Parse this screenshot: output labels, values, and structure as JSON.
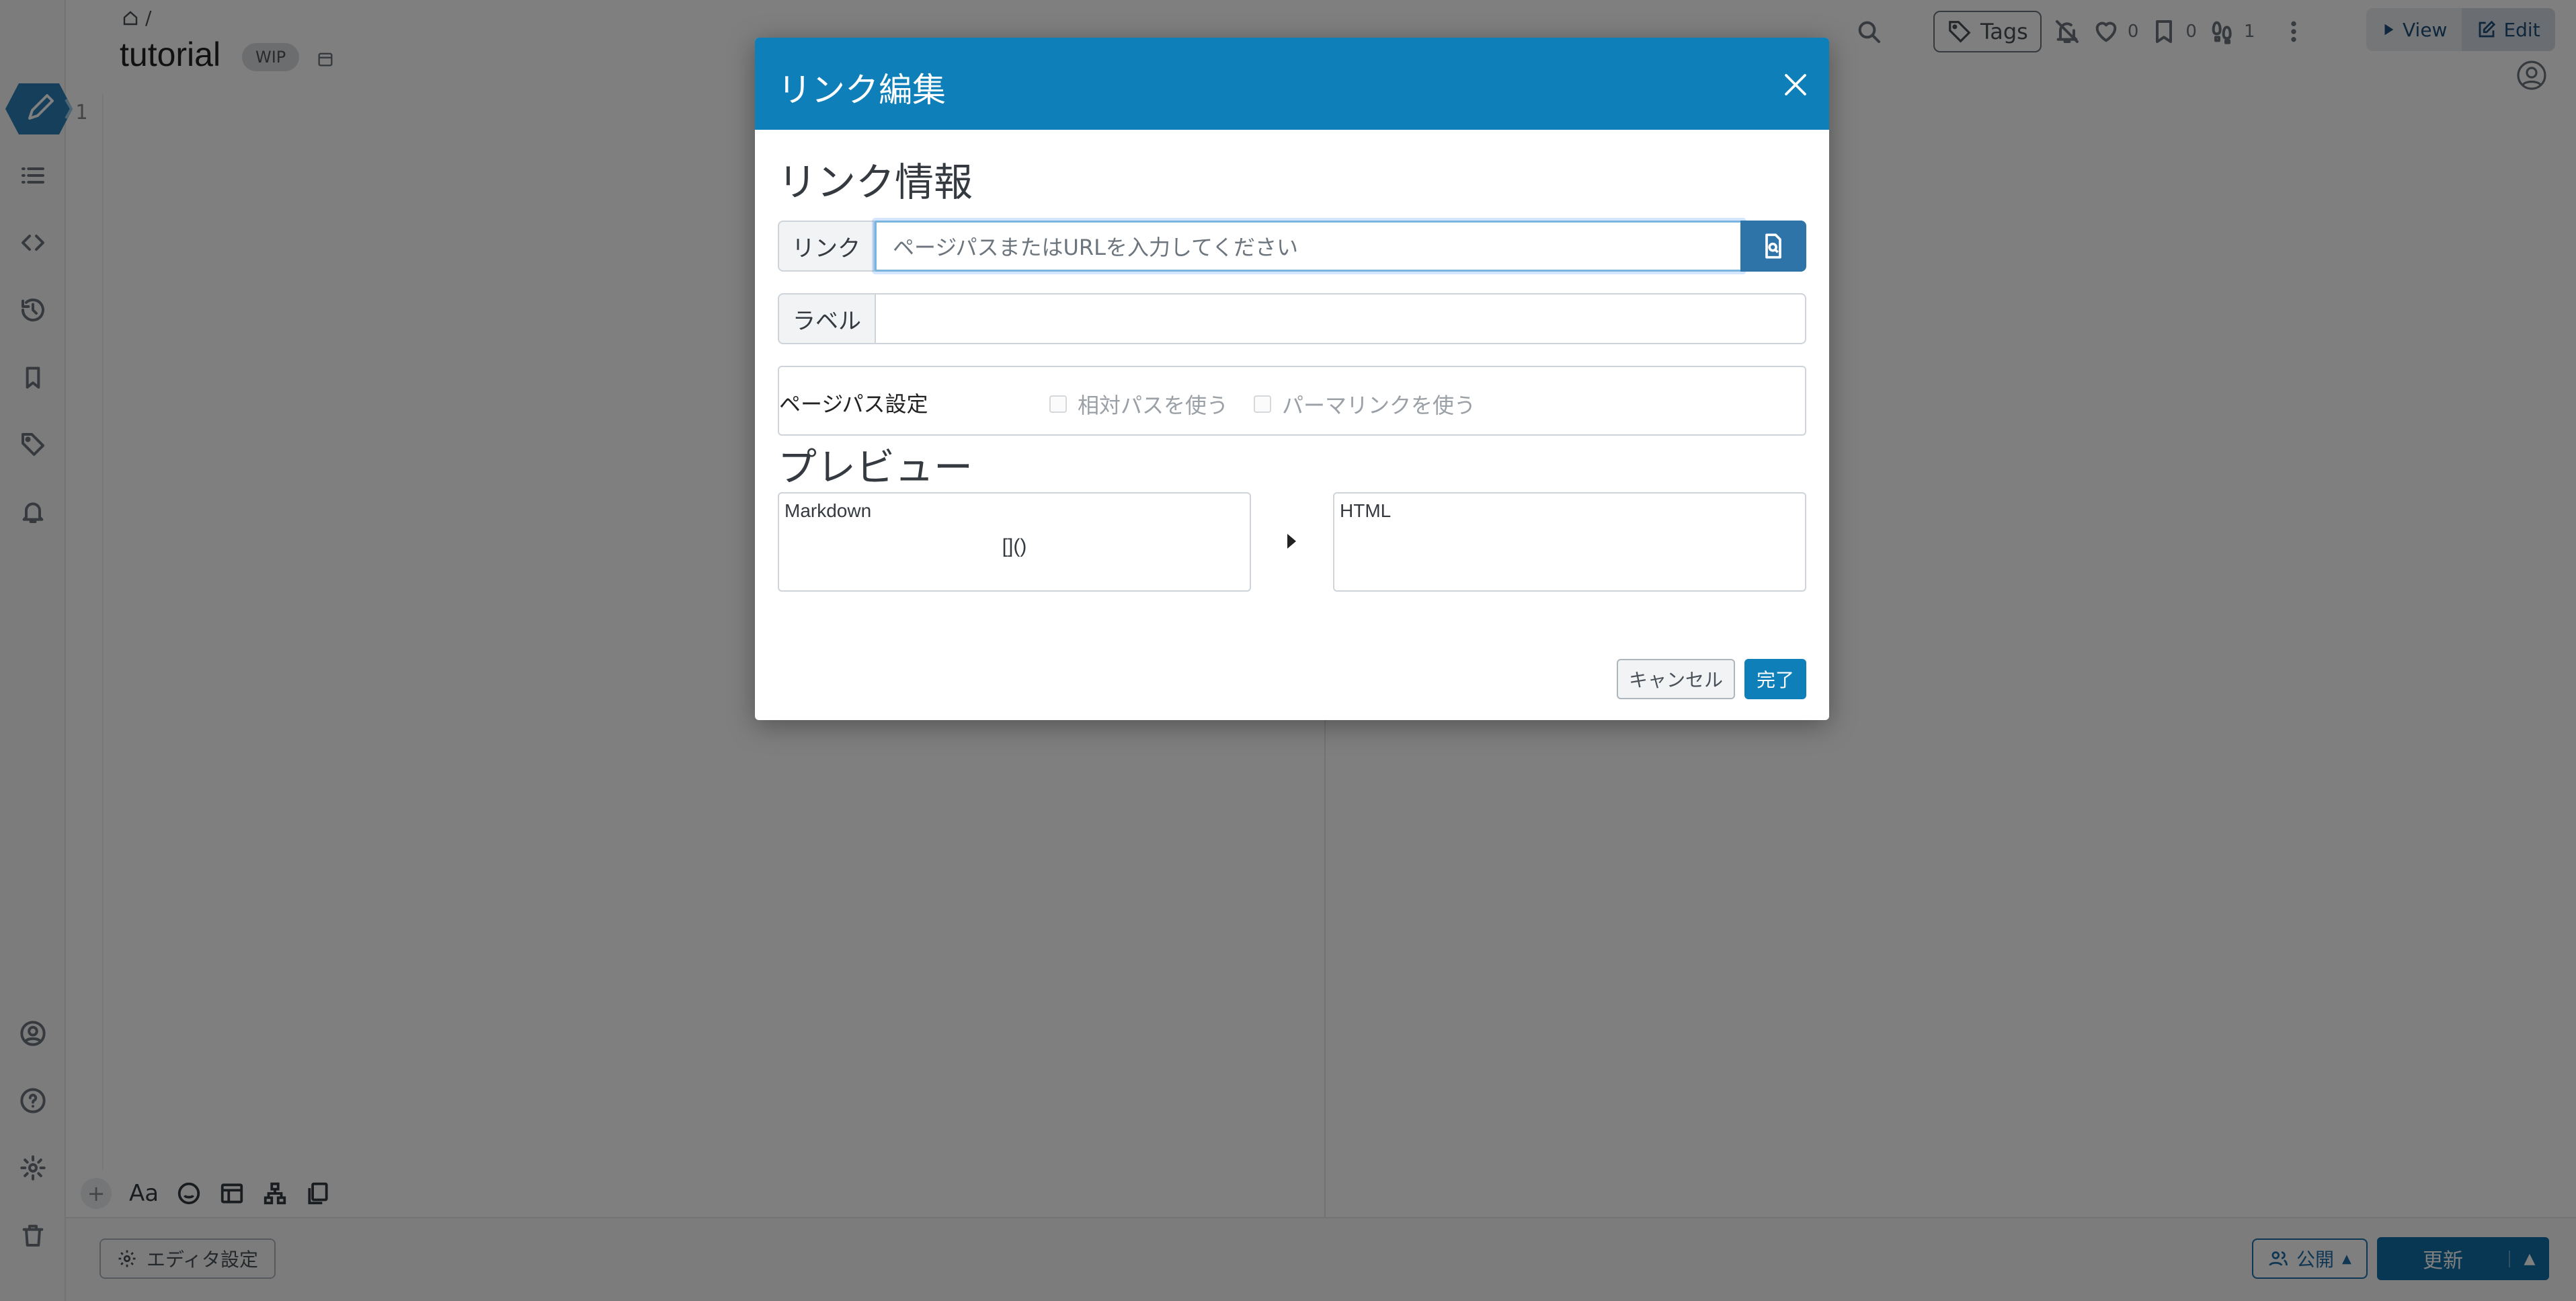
{
  "page": {
    "breadcrumb_sep": "/",
    "title": "tutorial",
    "wip_badge": "WIP",
    "gutter_line_number": "1"
  },
  "topbar": {
    "tags_label": "Tags",
    "like_count": "0",
    "bookmark_count": "0",
    "seen_count": "1",
    "view_label": "View",
    "edit_label": "Edit"
  },
  "bottom": {
    "editor_settings_label": "エディタ設定",
    "publish_label": "公開",
    "update_label": "更新"
  },
  "editor_toolbar": {
    "add": "+",
    "text_format": "Aa"
  },
  "modal": {
    "title": "リンク編集",
    "section_link_info": "リンク情報",
    "link_label": "リンク",
    "link_placeholder": "ページパスまたはURLを入力してください",
    "label_label": "ラベル",
    "label_value": "",
    "pagepath_label": "ページパス設定",
    "relative_path_label": "相対パスを使う",
    "permalink_label": "パーマリンクを使う",
    "section_preview": "プレビュー",
    "markdown_caption": "Markdown",
    "markdown_value": "[]()",
    "html_caption": "HTML",
    "cancel_label": "キャンセル",
    "done_label": "完了"
  },
  "colors": {
    "header_blue": "#0e7fb8",
    "button_blue": "#0e7fb8",
    "search_button": "#2f74a8"
  },
  "icons": [
    "home-icon",
    "pencil-icon",
    "list-icon",
    "code-icon",
    "history-icon",
    "bookmarks-icon",
    "tag-icon",
    "bell-icon",
    "user-icon",
    "help-icon",
    "gear-icon",
    "trash-icon",
    "search-icon",
    "bell-off-icon",
    "heart-icon",
    "bookmark-icon",
    "footprints-icon",
    "more-vertical-icon",
    "play-icon",
    "edit-square-icon",
    "close-icon",
    "file-search-icon",
    "arrow-right-icon"
  ]
}
